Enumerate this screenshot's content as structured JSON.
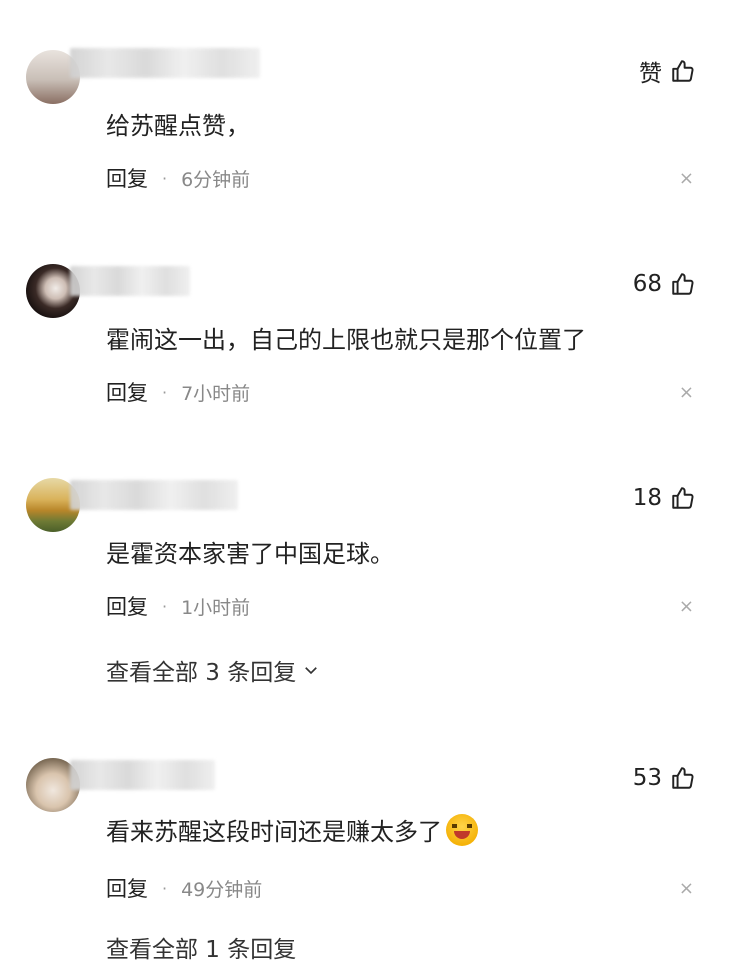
{
  "comments": [
    {
      "likes": "赞",
      "text": "给苏醒点赞，",
      "reply_label": "回复",
      "dot": "·",
      "time": "6分钟前",
      "close": "×"
    },
    {
      "likes": "68",
      "text": "霍闹这一出，自己的上限也就只是那个位置了",
      "reply_label": "回复",
      "dot": "·",
      "time": "7小时前",
      "close": "×"
    },
    {
      "likes": "18",
      "text": "是霍资本家害了中国足球。",
      "reply_label": "回复",
      "dot": "·",
      "time": "1小时前",
      "close": "×",
      "view_replies": "查看全部 3 条回复"
    },
    {
      "likes": "53",
      "text": "看来苏醒这段时间还是赚太多了",
      "reply_label": "回复",
      "dot": "·",
      "time": "49分钟前",
      "close": "×",
      "emoji_icon": "laughing-crying-emoji"
    }
  ],
  "partial_footer": "查看全部 1 条回复"
}
